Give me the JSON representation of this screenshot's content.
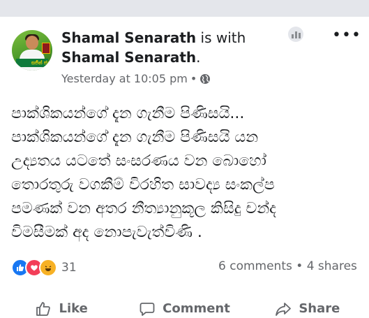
{
  "post": {
    "author_name": "Shamal Senarath",
    "with_text": " is with",
    "with_name": "Shamal Senarath",
    "period": ".",
    "timestamp": "Yesterday at 10:05 pm",
    "separator": "•",
    "privacy_icon": "globe-icon",
    "header_icons": [
      "insights-icon",
      "more-icon"
    ],
    "more_label": "•••",
    "avatar_text": "සජිත් ජය",
    "text_lines": [
      "පාක්ශිකයන්ගේ දැන ගැනීම පිණිසයි...",
      "පාක්ශිකයන්ගේ දැන ගැනීම පිණිසයි යන",
      "උද්‍යතය යටතේ සංසරණය වන බොහෝ",
      "තොරතුරු වගකීම් විරහිත සාවද්‍ය සංකල්ප",
      "පමණක් වන අතර නීත්‍යානුකූල කිසිදු චන්ද",
      "විමසීමක් අද නොපැවැත්විණි ."
    ]
  },
  "reactions": {
    "icons": [
      "like-reaction",
      "love-reaction",
      "haha-reaction"
    ],
    "count": "31"
  },
  "stats": {
    "comments": "6 comments",
    "separator": "•",
    "shares": "4 shares"
  },
  "actions": {
    "like": "Like",
    "comment": "Comment",
    "share": "Share"
  },
  "colors": {
    "like_blue": "#1877f2",
    "love_red": "#f33e58",
    "haha_yellow": "#f7b125",
    "secondary_text": "#65676b",
    "top_bar": "#e4e6eb"
  }
}
